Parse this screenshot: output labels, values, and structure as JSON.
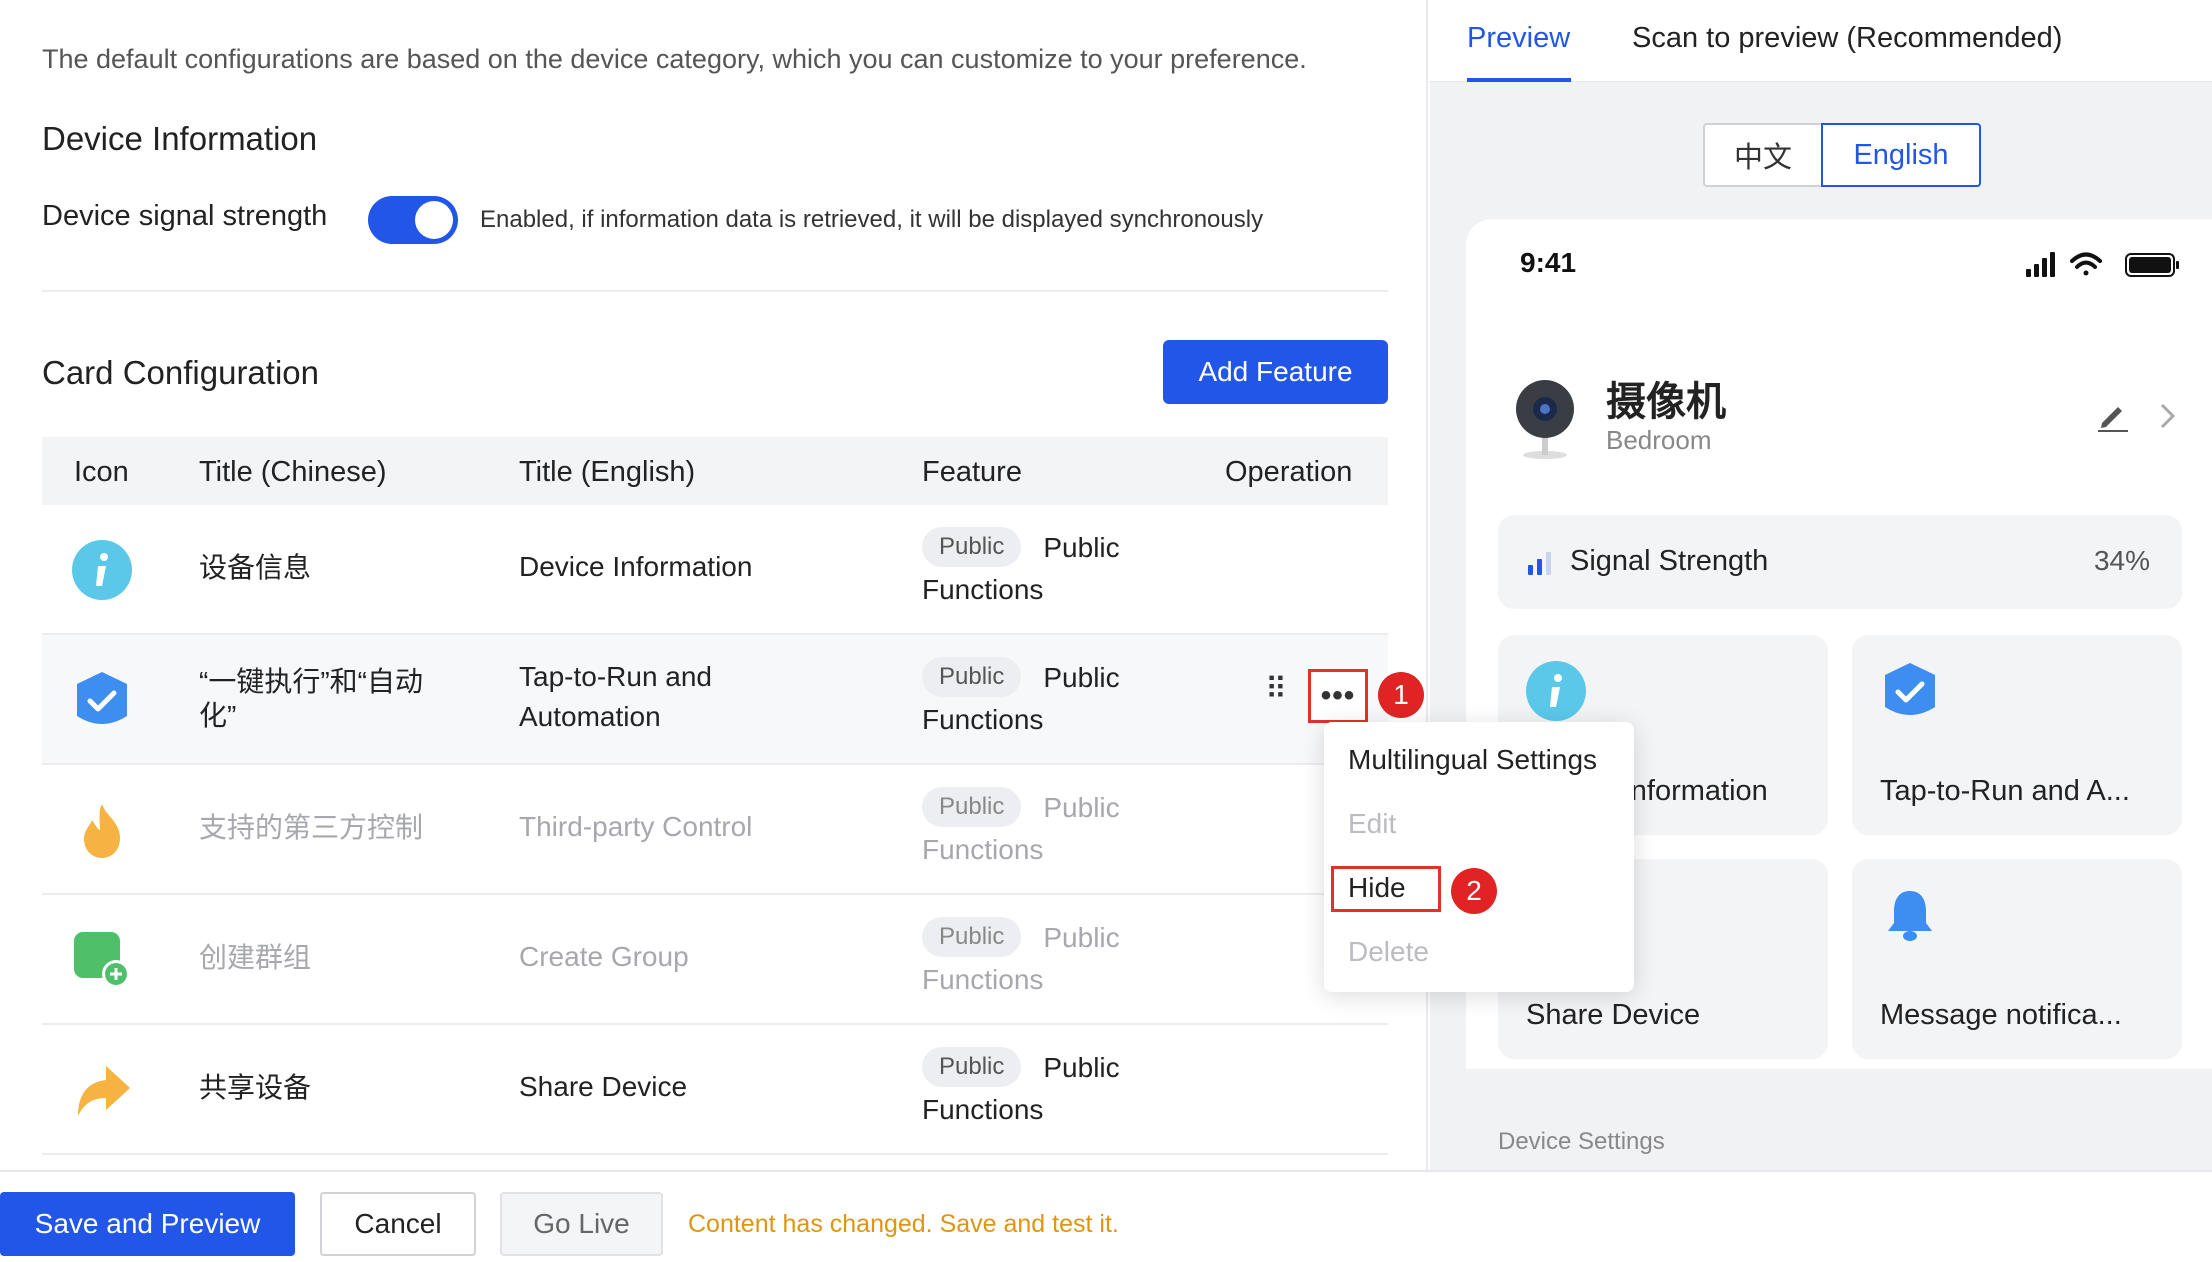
{
  "description": "The default configurations are based on the device category, which you can customize to your preference.",
  "device_info": {
    "heading": "Device Information",
    "signal_label": "Device signal strength",
    "signal_enabled": true,
    "signal_desc": "Enabled, if information data is retrieved, it will be displayed synchronously"
  },
  "card_config": {
    "heading": "Card Configuration",
    "add_button": "Add Feature",
    "columns": [
      "Icon",
      "Title (Chinese)",
      "Title (English)",
      "Feature",
      "Operation"
    ],
    "rows": [
      {
        "icon": "info-icon",
        "title_cn": "设备信息",
        "title_en": "Device Information",
        "tag": "Public",
        "feature": "Public Functions",
        "hidden": false
      },
      {
        "icon": "check-shield-icon",
        "title_cn": "“一键执行”和“自动化”",
        "title_en": "Tap-to-Run and Automation",
        "tag": "Public",
        "feature": "Public Functions",
        "hidden": false
      },
      {
        "icon": "flame-icon",
        "title_cn": "支持的第三方控制",
        "title_en": "Third-party Control",
        "tag": "Public",
        "feature": "Public Functions",
        "hidden": true
      },
      {
        "icon": "create-group-icon",
        "title_cn": "创建群组",
        "title_en": "Create Group",
        "tag": "Public",
        "feature": "Public Functions",
        "hidden": true
      },
      {
        "icon": "share-arrow-icon",
        "title_cn": "共享设备",
        "title_en": "Share Device",
        "tag": "Public",
        "feature": "Public Functions",
        "hidden": false
      }
    ]
  },
  "operation_menu": {
    "items": [
      "Multilingual Settings",
      "Edit",
      "Hide",
      "Delete"
    ],
    "step1": "1",
    "step2": "2"
  },
  "footer": {
    "save": "Save and Preview",
    "cancel": "Cancel",
    "go_live": "Go Live",
    "message": "Content has changed. Save and test it."
  },
  "preview": {
    "tabs": [
      "Preview",
      "Scan to preview (Recommended)"
    ],
    "languages": [
      "中文",
      "English"
    ],
    "selected_language": "English",
    "time": "9:41",
    "device_name": "摄像机",
    "room": "Bedroom",
    "signal_label": "Signal Strength",
    "signal_value": "34%",
    "tiles": [
      "Device Information",
      "Tap-to-Run and A...",
      "Share Device",
      "Message notifica..."
    ],
    "section": "Device Settings"
  },
  "colors": {
    "primary": "#2156e8",
    "warning": "#e0950f",
    "highlight": "#e2302b"
  }
}
